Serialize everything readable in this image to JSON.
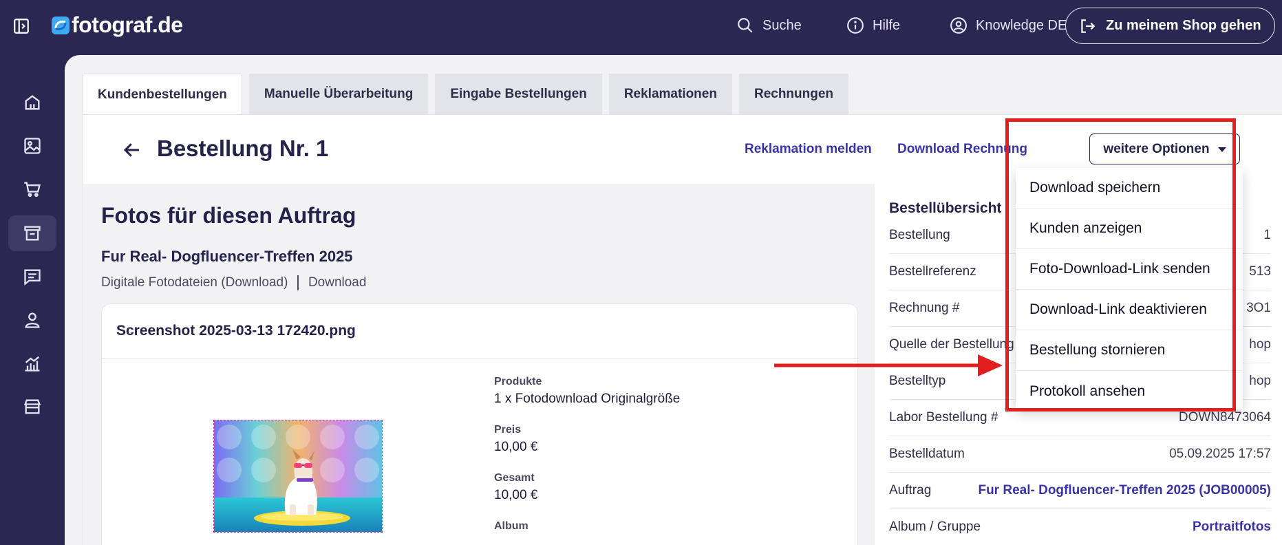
{
  "topbar": {
    "logo_text": "fotograf.de",
    "nav": [
      {
        "label": "Suche",
        "icon": "search-icon"
      },
      {
        "label": "Hilfe",
        "icon": "info-icon"
      },
      {
        "label": "Knowledge DE",
        "icon": "user-circle-icon"
      }
    ],
    "shop_button": "Zu meinem Shop gehen"
  },
  "rail": {
    "items": [
      "home-icon",
      "image-icon",
      "cart-icon",
      "orders-box-icon",
      "chat-icon",
      "person-icon",
      "chart-icon",
      "store-icon"
    ],
    "active_index": 3
  },
  "tabs": [
    {
      "label": "Kundenbestellungen",
      "active": true
    },
    {
      "label": "Manuelle Überarbeitung",
      "active": false
    },
    {
      "label": "Eingabe Bestellungen",
      "active": false
    },
    {
      "label": "Reklamationen",
      "active": false
    },
    {
      "label": "Rechnungen",
      "active": false
    }
  ],
  "header": {
    "title": "Bestellung Nr. 1",
    "report_link": "Reklamation melden",
    "invoice_link": "Download Rechnung",
    "more_button": "weitere Optionen"
  },
  "dropdown": {
    "items": [
      "Download speichern",
      "Kunden anzeigen",
      "Foto-Download-Link senden",
      "Download-Link deaktivieren",
      "Bestellung stornieren",
      "Protokoll ansehen"
    ]
  },
  "photos": {
    "section_title": "Fotos für diesen Auftrag",
    "job_title": "Fur Real- Dogfluencer-Treffen 2025",
    "meta_type": "Digitale Fotodateien (Download)",
    "meta_delivery": "Download",
    "file_name": "Screenshot 2025-03-13 172420.png",
    "fields": [
      {
        "label": "Produkte",
        "value": "1 x Fotodownload Originalgröße"
      },
      {
        "label": "Preis",
        "value": "10,00 €"
      },
      {
        "label": "Gesamt",
        "value": "10,00 €"
      },
      {
        "label": "Album",
        "value": ""
      }
    ]
  },
  "summary": {
    "title": "Bestellübersicht",
    "rows": [
      {
        "label": "Bestellung",
        "value": "1"
      },
      {
        "label": "Bestellreferenz",
        "value": "513"
      },
      {
        "label": "Rechnung #",
        "value": "3O1"
      },
      {
        "label": "Quelle der Bestellung",
        "value": "hop"
      },
      {
        "label": "Bestelltyp",
        "value": "hop"
      },
      {
        "label": "Labor Bestellung #",
        "value": "DOWN8473064"
      },
      {
        "label": "Bestelldatum",
        "value": "05.09.2025 17:57"
      },
      {
        "label": "Auftrag",
        "value": "Fur Real- Dogfluencer-Treffen 2025 (JOB00005)"
      },
      {
        "label": "Album / Gruppe",
        "value": "Portraitfotos"
      }
    ]
  },
  "colors": {
    "navy": "#2b2752",
    "link": "#3a33a8",
    "annotation_red": "#e21f1f"
  }
}
